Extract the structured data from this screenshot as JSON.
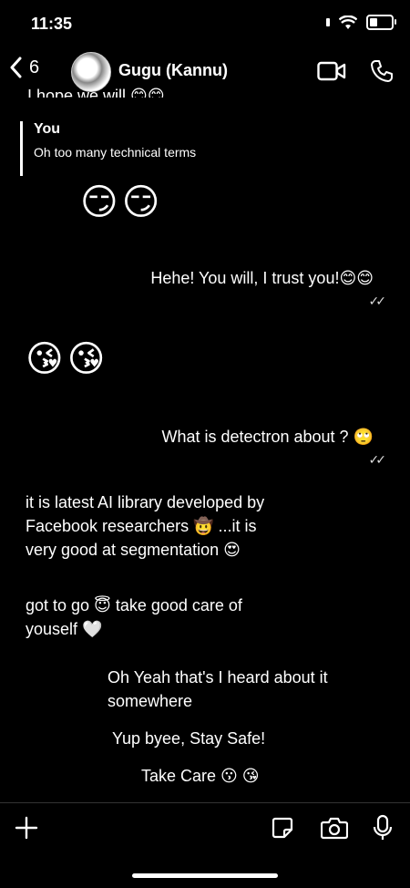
{
  "status_bar": {
    "time": "11:35"
  },
  "header": {
    "back_count": "6",
    "contact_name": "Gugu (Kannu)"
  },
  "messages": {
    "cutoff_text": "I hope we will 😊😊",
    "quote_sender": "You",
    "quote_text": "Oh too many technical terms",
    "emoji_1": "😏😏",
    "sent_1": "Hehe! You will, I trust you!😊😊",
    "tick_1": "✓✓",
    "emoji_2": "😘😘",
    "sent_2": "What is detectron about ? 🙄",
    "tick_2": "✓✓",
    "recv_1": "it is latest AI library developed by\nFacebook researchers 🤠 ...it is\nvery good at segmentation 😍",
    "recv_2": "got to go 😇 take good care of\nyouself 🤍",
    "sent_3": "Oh Yeah that's I heard about it\nsomewhere",
    "sent_4": "Yup byee, Stay Safe!",
    "sent_5": "Take Care 😗 😘"
  },
  "icons": {
    "back": "chevron-left-icon",
    "video": "video-camera-icon",
    "call": "phone-icon",
    "add": "plus-icon",
    "sticker": "sticker-icon",
    "camera": "camera-icon",
    "mic": "microphone-icon"
  }
}
